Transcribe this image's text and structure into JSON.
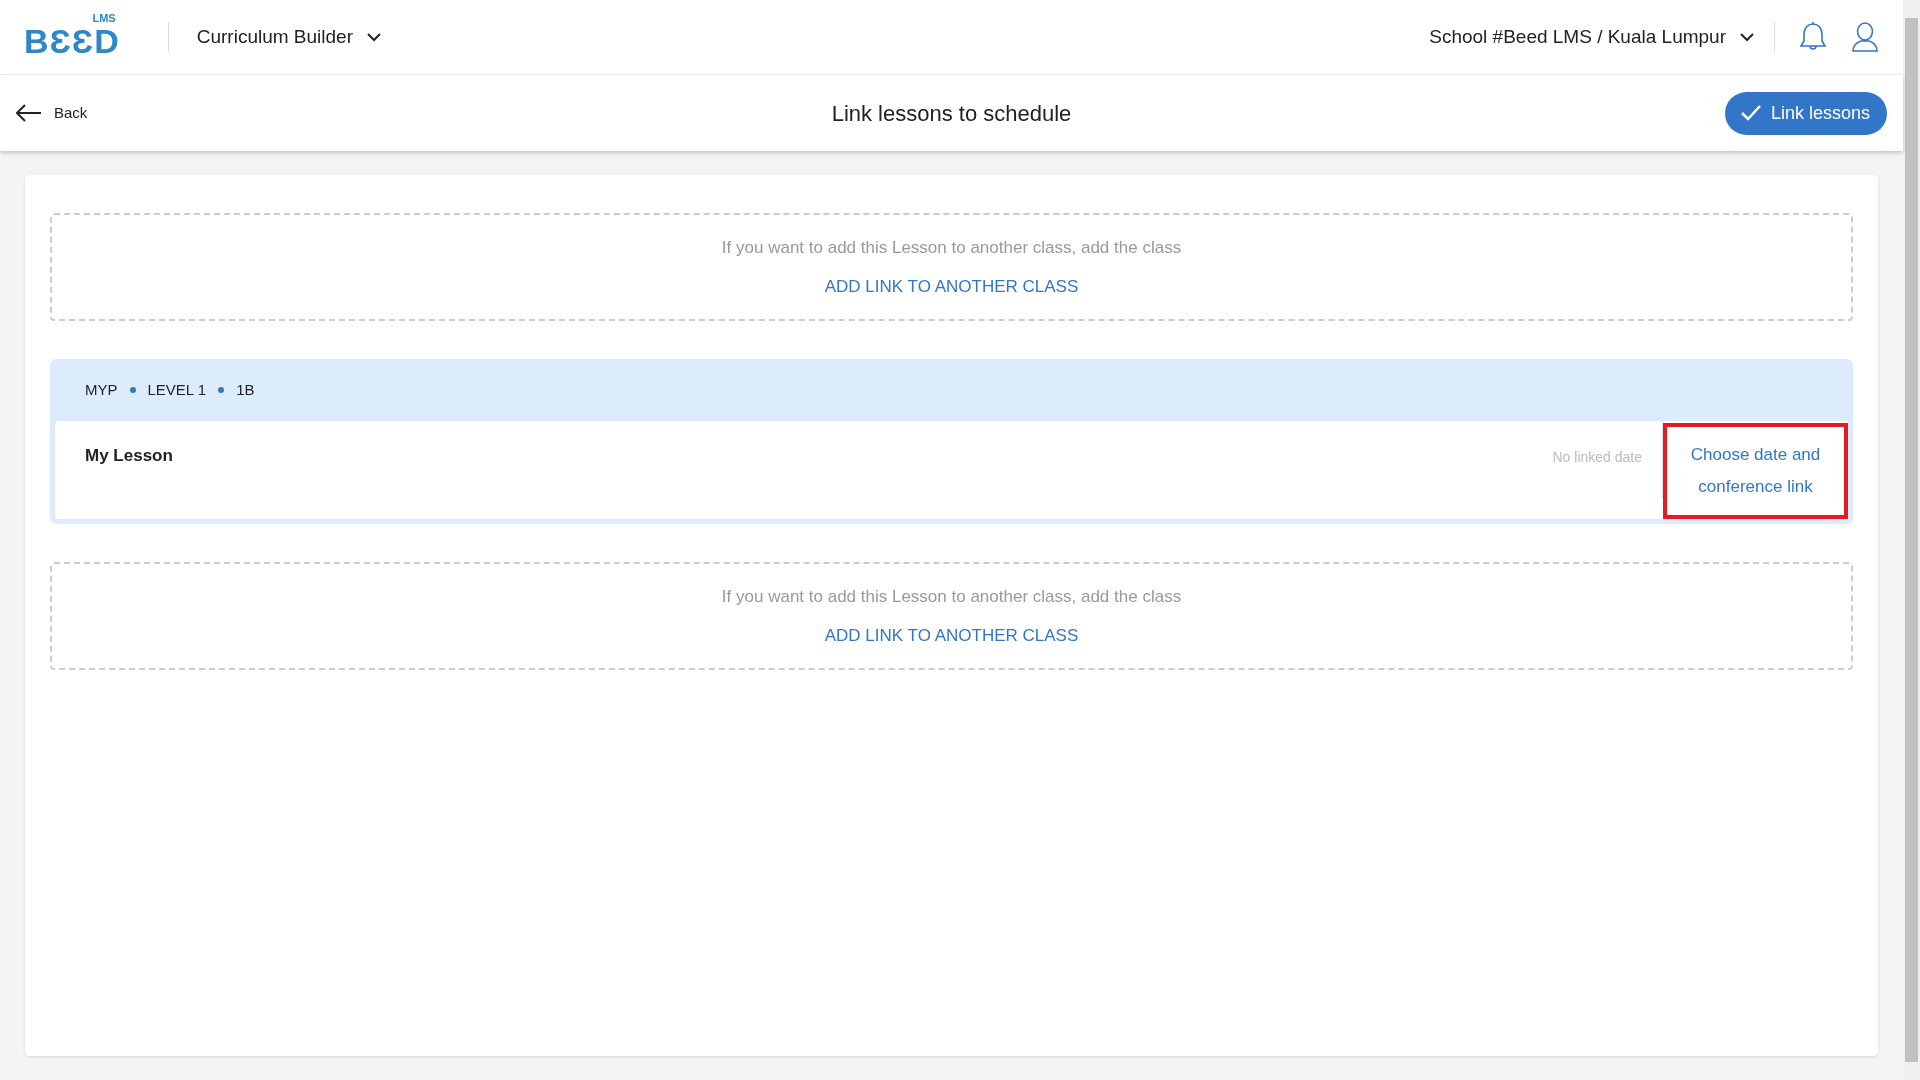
{
  "logo": {
    "superscript": "LMS",
    "wordmark": "BƐƐD"
  },
  "module_menu": {
    "label": "Curriculum Builder"
  },
  "school_menu": {
    "label": "School #Beed LMS / Kuala Lumpur"
  },
  "subheader": {
    "back": "Back",
    "title": "Link lessons to schedule",
    "action": "Link lessons"
  },
  "add_link_boxes": [
    {
      "hint": "If you want to add this Lesson to another class, add the class",
      "link": "ADD LINK TO ANOTHER CLASS"
    },
    {
      "hint": "If you want to add this Lesson to another class, add the class",
      "link": "ADD LINK TO ANOTHER CLASS"
    }
  ],
  "class_group": {
    "breadcrumb": [
      "MYP",
      "LEVEL 1",
      "1B"
    ],
    "lessons": [
      {
        "title": "My Lesson",
        "date": "No linked date",
        "action": "Choose date and conference link",
        "highlighted": true
      }
    ]
  }
}
